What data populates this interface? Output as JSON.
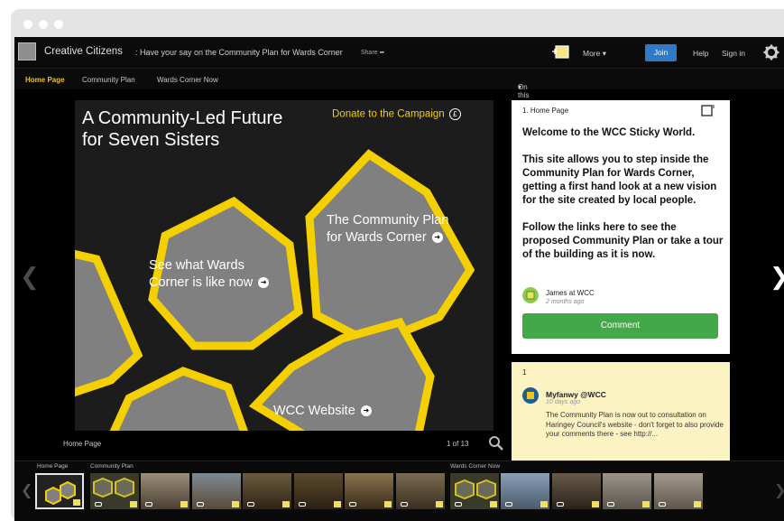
{
  "topbar": {
    "brand": "Creative Citizens",
    "breadcrumb": ": Have your say on the Community Plan for Wards Corner",
    "share_label": "Share",
    "more_label": "More",
    "join_label": "Join",
    "help_label": "Help",
    "signin_label": "Sign in"
  },
  "subnav": {
    "tabs": [
      {
        "label": "Home Page",
        "active": true
      },
      {
        "label": "Community Plan",
        "active": false
      },
      {
        "label": "Wards Corner Now",
        "active": false
      }
    ],
    "on_this_slide": "On this slide"
  },
  "slide": {
    "title": "A Community-Led Future for Seven Sisters",
    "donate": "Donate to the Campaign",
    "donate_symbol": "£",
    "hex_links": [
      {
        "label": "See what Wards Corner is like now"
      },
      {
        "label": "The Community Plan for Wards Corner"
      },
      {
        "label": "WCC Website"
      }
    ],
    "page_name": "Home Page",
    "page_count": "1 of 13"
  },
  "panel1": {
    "title": "1. Home Page",
    "heading": "Welcome to the WCC Sticky World.",
    "para1": "This site allows you to step inside the Community Plan for Wards Corner, getting a first hand look at a new vision for the site created by local people.",
    "para2": "Follow the links here to see the proposed Community Plan or take a tour of the building as it is now.",
    "author": "James at WCC",
    "time": "2 months ago",
    "comment_label": "Comment"
  },
  "panel2": {
    "number": "1",
    "author": "Myfanwy @WCC",
    "time": "10 days ago",
    "message": "The Community Plan is now out to consultation on Haringey Council's website - don't forget to also provide your comments there - see http://..."
  },
  "strip": {
    "groups": [
      {
        "label": "Home Page"
      },
      {
        "label": "Community Plan"
      },
      {
        "label": "Wards Corner Now"
      }
    ]
  },
  "colors": {
    "accent_yellow": "#f5d000",
    "join_blue": "#2f79c8",
    "comment_green": "#43a84a",
    "note_yellow": "#fcf3c2"
  }
}
